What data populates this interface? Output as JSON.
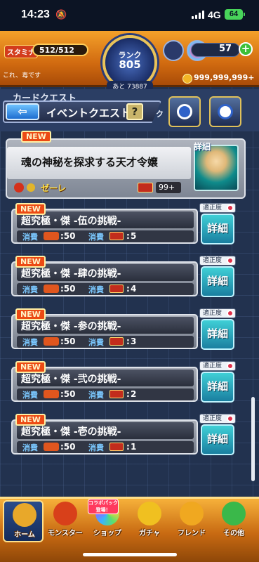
{
  "status_bar": {
    "time": "14:23",
    "network": "4G",
    "battery": "64"
  },
  "hud": {
    "stamina_label": "スタミナ",
    "stamina": "512/512",
    "rank_title": "ランク",
    "rank": "805",
    "rank_next": "あと 73887",
    "orb_count": "57",
    "plus_label": "+",
    "gold": "999,999,999+",
    "ticker": "これ、毒です"
  },
  "nav": {
    "card_quest": "カードクエスト",
    "back_label": "⇦",
    "title": "イベントクエスト",
    "help_label": "?",
    "ku": "ク"
  },
  "event": {
    "new_badge": "NEW",
    "detail_label": "詳細",
    "title": "魂の神秘を探求する天才令嬢",
    "boss": "ゼーレ",
    "ticket_count": "99+"
  },
  "quest_common": {
    "new_badge": "NEW",
    "fit_label": "適正度",
    "detail_label": "詳細",
    "cost_label": "消費",
    "stamina_cost": ":50",
    "ticket_prefix": ":"
  },
  "quests": [
    {
      "title": "超究極・傑 -伍の挑戦-",
      "ticket_cost": "5"
    },
    {
      "title": "超究極・傑 -肆の挑戦-",
      "ticket_cost": "4"
    },
    {
      "title": "超究極・傑 -参の挑戦-",
      "ticket_cost": "3"
    },
    {
      "title": "超究極・傑 -弐の挑戦-",
      "ticket_cost": "2"
    },
    {
      "title": "超究極・傑 -壱の挑戦-",
      "ticket_cost": "1"
    }
  ],
  "tabbar": {
    "collab_badge": "コラボパック登場！",
    "tabs": [
      {
        "label": "ホーム",
        "icon": "home-icon",
        "color": "#e8a82a"
      },
      {
        "label": "モンスター",
        "icon": "monster-icon",
        "color": "#d8401a"
      },
      {
        "label": "ショップ",
        "icon": "shop-icon",
        "color": "#8a60e0"
      },
      {
        "label": "ガチャ",
        "icon": "gacha-icon",
        "color": "#f0c020"
      },
      {
        "label": "フレンド",
        "icon": "friend-icon",
        "color": "#f0a820"
      },
      {
        "label": "その他",
        "icon": "other-icon",
        "color": "#3ab84a"
      }
    ]
  },
  "colors": {
    "accent": "#f4a12a",
    "detail_button": "#3fcfd6",
    "new_badge": "#ec4a14"
  }
}
